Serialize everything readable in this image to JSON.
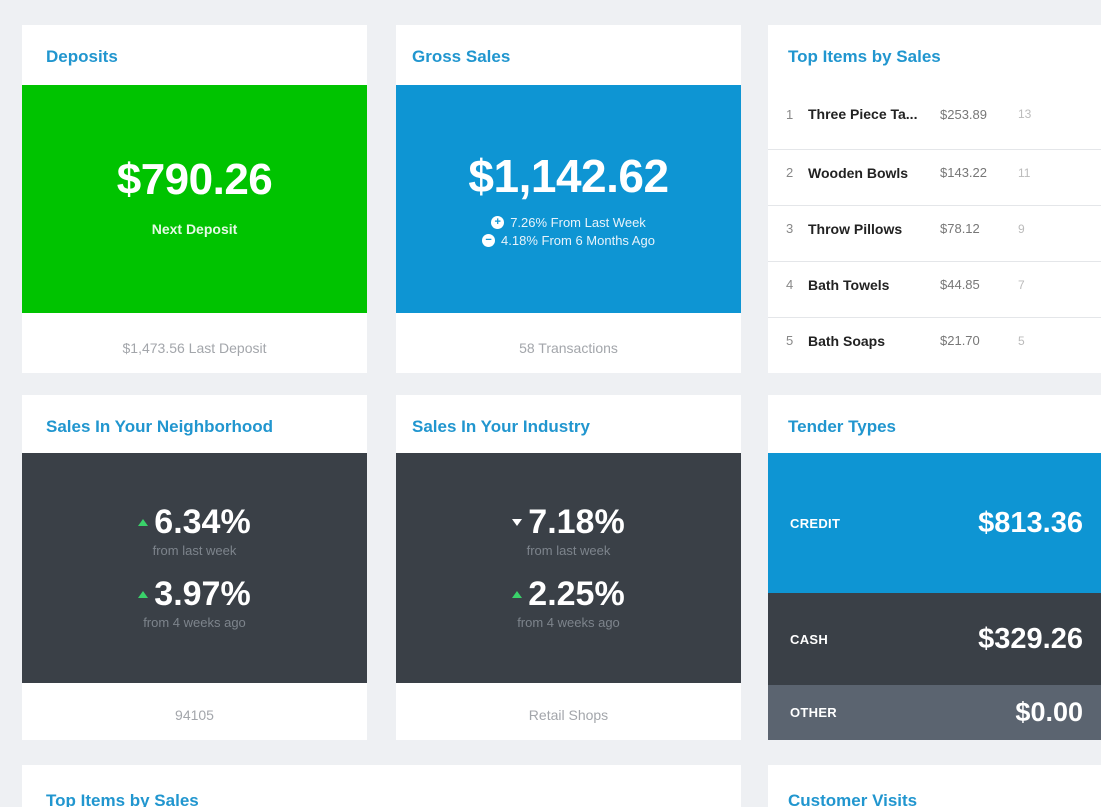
{
  "deposits": {
    "title": "Deposits",
    "amount": "$790.26",
    "label": "Next Deposit",
    "footer": "$1,473.56 Last Deposit",
    "color": "#00c300"
  },
  "gross_sales": {
    "title": "Gross Sales",
    "amount": "$1,142.62",
    "changes": [
      {
        "icon": "plus-circle-icon",
        "text": "7.26% From Last Week"
      },
      {
        "icon": "minus-circle-icon",
        "text": "4.18% From 6 Months Ago"
      }
    ],
    "footer": "58 Transactions",
    "color": "#0e95d3"
  },
  "top_items_side": {
    "title": "Top Items by Sales",
    "items": [
      {
        "rank": "1",
        "name": "Three Piece Ta...",
        "amount": "$253.89",
        "qty": "13"
      },
      {
        "rank": "2",
        "name": "Wooden Bowls",
        "amount": "$143.22",
        "qty": "11"
      },
      {
        "rank": "3",
        "name": "Throw Pillows",
        "amount": "$78.12",
        "qty": "9"
      },
      {
        "rank": "4",
        "name": "Bath Towels",
        "amount": "$44.85",
        "qty": "7"
      },
      {
        "rank": "5",
        "name": "Bath Soaps",
        "amount": "$21.70",
        "qty": "5"
      }
    ]
  },
  "neighborhood": {
    "title": "Sales In Your Neighborhood",
    "primary": {
      "value": "6.34%",
      "direction": "up",
      "caption": "from last week"
    },
    "secondary": {
      "value": "3.97%",
      "direction": "up",
      "caption": "from 4 weeks ago"
    },
    "footer": "94105"
  },
  "industry": {
    "title": "Sales In Your Industry",
    "primary": {
      "value": "7.18%",
      "direction": "down",
      "caption": "from last week"
    },
    "secondary": {
      "value": "2.25%",
      "direction": "up",
      "caption": "from 4 weeks ago"
    },
    "footer": "Retail Shops"
  },
  "tender_types": {
    "title": "Tender Types",
    "rows": [
      {
        "label": "CREDIT",
        "amount": "$813.36",
        "color": "#0e95d3"
      },
      {
        "label": "CASH",
        "amount": "$329.26",
        "color": "#3a4047"
      },
      {
        "label": "OTHER",
        "amount": "$0.00",
        "color": "#5b6470"
      }
    ]
  },
  "bottom_left": {
    "title": "Top Items by Sales"
  },
  "bottom_right": {
    "title": "Customer Visits"
  },
  "colors": {
    "accent": "#2196cf",
    "dark_panel": "#3a4047",
    "up_arrow": "#3ad26a"
  }
}
